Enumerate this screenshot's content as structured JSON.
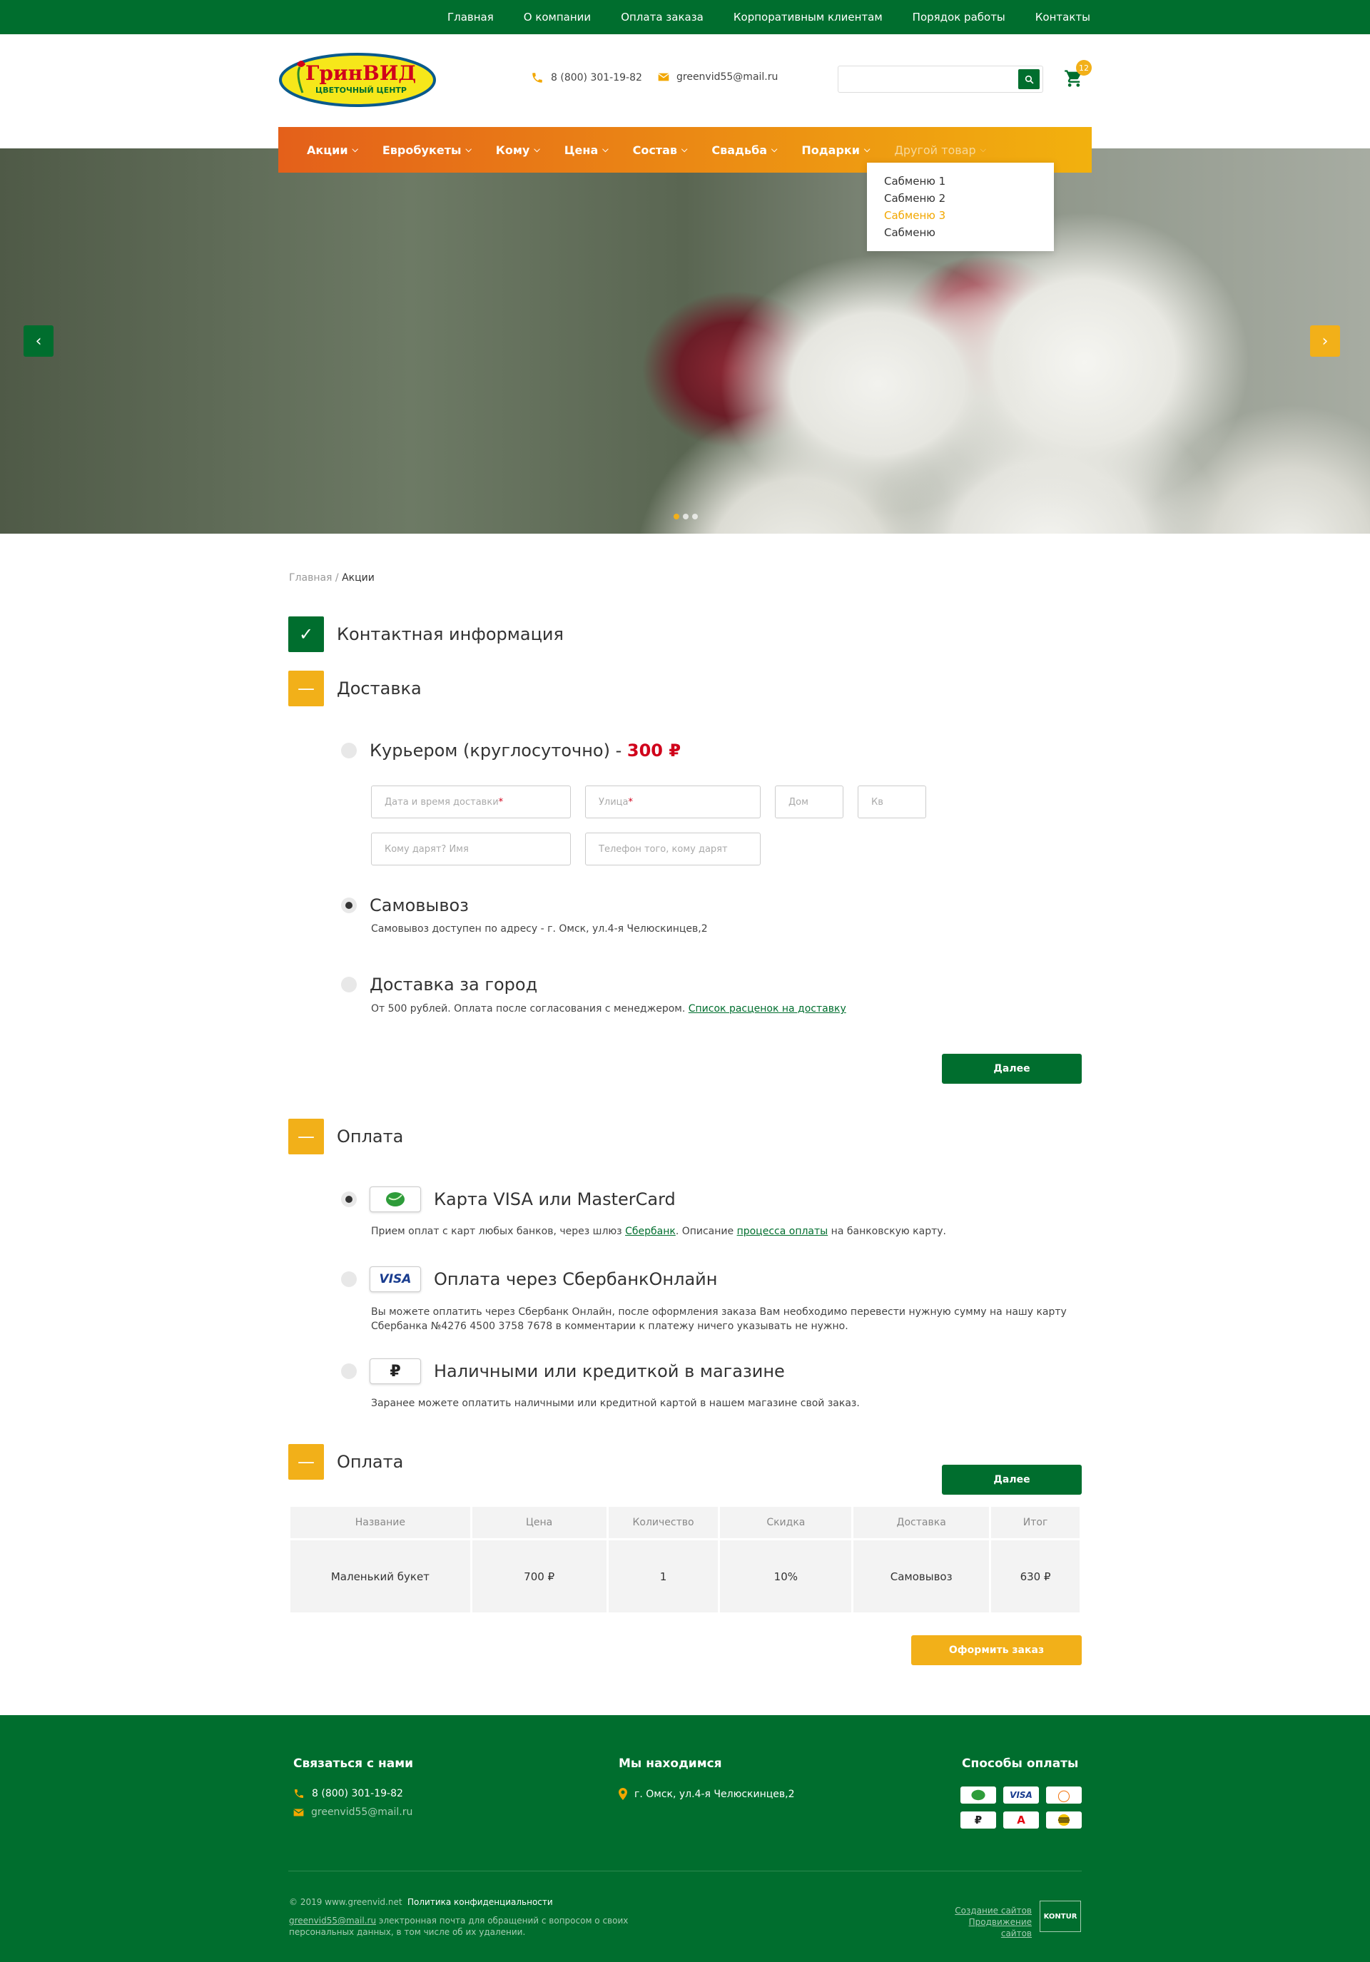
{
  "topnav": [
    "Главная",
    "О компании",
    "Оплата заказа",
    "Корпоративным клиентам",
    "Порядок работы",
    "Контакты"
  ],
  "header": {
    "logo_name": "ГринВИД",
    "logo_sub": "ЦВЕТОЧНЫЙ ЦЕНТР",
    "phone": "8 (800) 301-19-82",
    "email": "greenvid55@mail.ru",
    "cart_count": "12"
  },
  "menu": [
    {
      "label": "Акции"
    },
    {
      "label": "Евробукеты"
    },
    {
      "label": "Кому"
    },
    {
      "label": "Цена"
    },
    {
      "label": "Состав"
    },
    {
      "label": "Свадьба"
    },
    {
      "label": "Подарки"
    },
    {
      "label": "Другой товар"
    }
  ],
  "dropdown": [
    "Сабменю 1",
    "Сабменю 2",
    "Сабменю 3",
    "Сабменю"
  ],
  "breadcrumb": {
    "home": "Главная",
    "sep": " / ",
    "current": "Акции"
  },
  "steps": {
    "contact": "Контактная информация",
    "delivery": "Доставка",
    "payment": "Оплата",
    "order": "Оплата"
  },
  "delivery": {
    "courier_label": "Курьером (круглосуточно) - ",
    "courier_price": "300 ₽",
    "fields": {
      "datetime": "Дата и время доставки",
      "street": "Улица",
      "house": "Дом",
      "apt": "Кв",
      "recipient": "Кому дарят? Имя",
      "phone": "Телефон того, кому дарят"
    },
    "pickup_label": "Самовывоз",
    "pickup_desc": "Самовывоз доступен по адресу - г. Омск, ул.4-я Челюскинцев,2",
    "out_label": "Доставка за город",
    "out_desc": "От 500 рублей. Оплата после согласования с менеджером. ",
    "out_link": "Список расценок на доставку",
    "next": "Далее"
  },
  "payment": {
    "card_label": "Карта VISA или MasterCard",
    "card_desc_1": "Прием оплат с карт любых банков, через шлюз ",
    "card_link_1": "Сбербанк",
    "card_desc_2": ". Описание ",
    "card_link_2": "процесса оплаты",
    "card_desc_3": " на банковскую карту.",
    "sber_label": "Оплата через СбербанкОнлайн",
    "sber_desc_1": "Вы можете оплатить через Сбербанк Онлайн, после оформления заказа Вам необходимо перевести нужную сумму на нашу карту",
    "sber_desc_2": "Сбербанка №4276 4500 3758 7678 в комментарии к платежу ничего указывать не нужно.",
    "visa_badge": "VISA",
    "cash_badge": "₽",
    "cash_label": "Наличными или кредиткой в магазине",
    "cash_desc": "Заранее можете оплатить наличными или кредитной картой в нашем магазине свой заказ.",
    "next": "Далее"
  },
  "table": {
    "headers": [
      "Название",
      "Цена",
      "Количество",
      "Скидка",
      "Доставка",
      "Итог"
    ],
    "rows": [
      [
        "Маленький букет",
        "700 ₽",
        "1",
        "10%",
        "Самовывоз",
        "630 ₽"
      ]
    ]
  },
  "submit": "Оформить заказ",
  "footer": {
    "contact_head": "Связаться с нами",
    "phone": "8 (800) 301-19-82",
    "email": "greenvid55@mail.ru",
    "location_head": "Мы находимся",
    "address": "г. Омск, ул.4-я Челюскинцев,2",
    "payment_head": "Способы оплаты",
    "badges": [
      "VISA",
      "₽",
      "А"
    ],
    "copyright": "© 2019 www.greenvid.net",
    "policy": "Политика конфиденциальности",
    "note_email": "greenvid55@mail.ru",
    "note_text_1": " электронная почта для обращений с вопросом о своих",
    "note_text_2": "персональных данных, в том числе об их удалении.",
    "creator_1": "Создание сайтов",
    "creator_2": "Продвижение сайтов",
    "kontur": "KONTUR"
  },
  "colors": {
    "green": "#006e2e",
    "orange": "#f2b019",
    "menu_start": "#e4601a",
    "price_red": "#d0021b"
  },
  "icons": [
    "phone-icon",
    "mail-icon",
    "search-icon",
    "cart-icon",
    "chevron-down-icon",
    "arrow-left-icon",
    "arrow-right-icon",
    "check-icon",
    "minus-icon",
    "location-icon"
  ]
}
